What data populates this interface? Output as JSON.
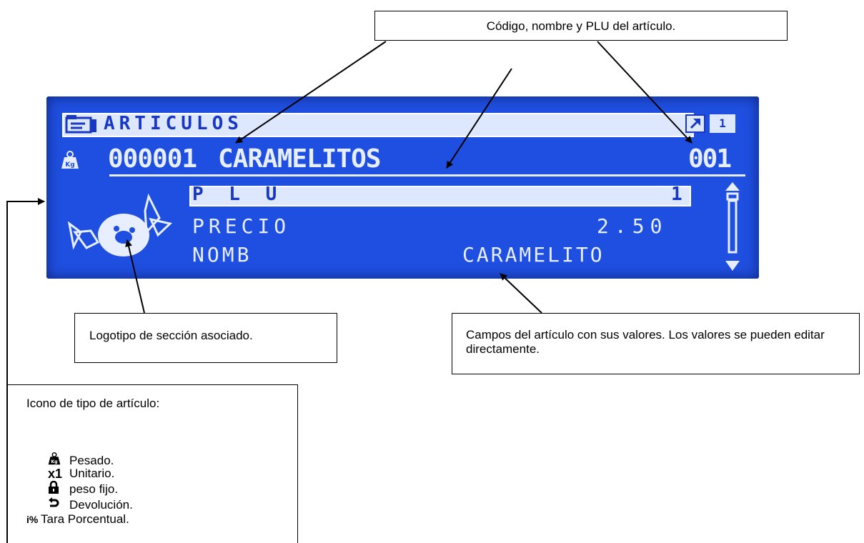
{
  "lcd": {
    "title": "ARTICULOS",
    "page_number": "1",
    "item_code": "000001",
    "item_name": "CARAMELITOS",
    "item_plu": "001",
    "fields": [
      {
        "label": "P L U",
        "value": "1"
      },
      {
        "label": "PRECIO",
        "value": "2.50"
      },
      {
        "label": "NOMB",
        "value": "CARAMELITO"
      }
    ]
  },
  "callouts": {
    "top": "Código, nombre y PLU del artículo.",
    "logo": "Logotipo de sección asociado.",
    "fields": "Campos del artículo con sus valores. Los valores se pueden editar directamente."
  },
  "legend": {
    "title": "Icono de tipo de artículo:",
    "items": [
      {
        "icon": "weight-icon",
        "label": "Pesado."
      },
      {
        "icon": "unit-icon",
        "label": "Unitario."
      },
      {
        "icon": "lock-icon",
        "label": "peso fijo."
      },
      {
        "icon": "return-icon",
        "label": "Devolución."
      },
      {
        "icon": "percent-tare-icon",
        "label": "Tara Porcentual."
      }
    ]
  }
}
